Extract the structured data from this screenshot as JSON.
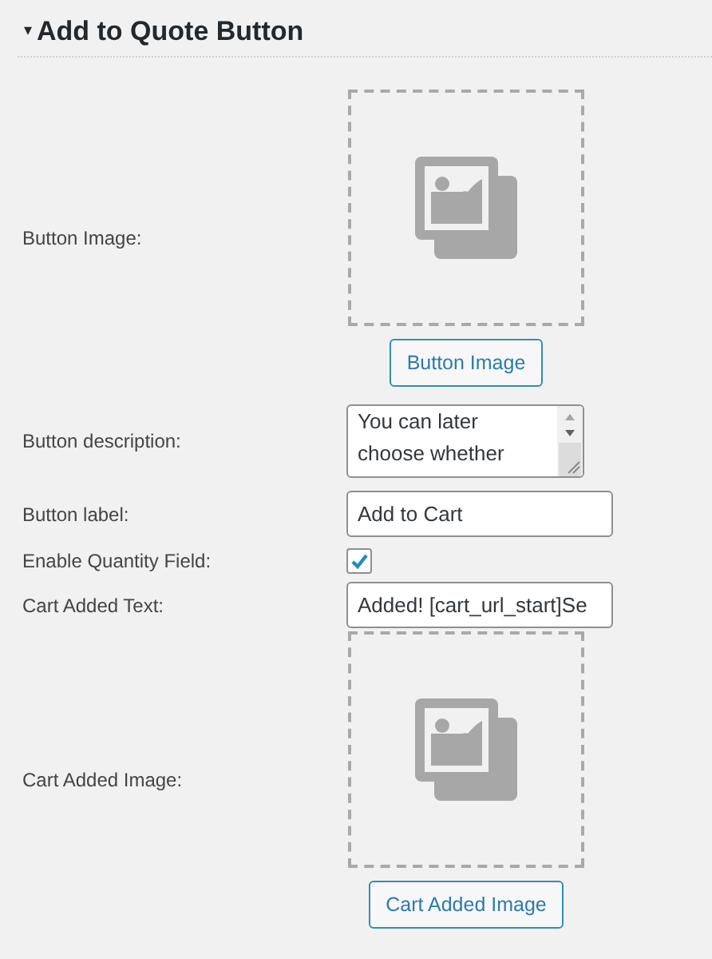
{
  "section": {
    "toggle": "▾",
    "title": "Add to Quote Button",
    "expanded": true
  },
  "fields": [
    {
      "kind": "image",
      "label": "Button Image:",
      "button": "Button Image"
    },
    {
      "kind": "textarea",
      "label": "Button description:",
      "value": "You can later choose whether"
    },
    {
      "kind": "text",
      "label": "Button label:",
      "value": "Add to Cart"
    },
    {
      "kind": "checkbox",
      "label": "Enable Quantity Field:",
      "checked": true
    },
    {
      "kind": "text",
      "label": "Cart Added Text:",
      "value": "Added! [cart_url_start]Se"
    },
    {
      "kind": "image",
      "label": "Cart Added Image:",
      "button": "Cart Added Image"
    }
  ]
}
